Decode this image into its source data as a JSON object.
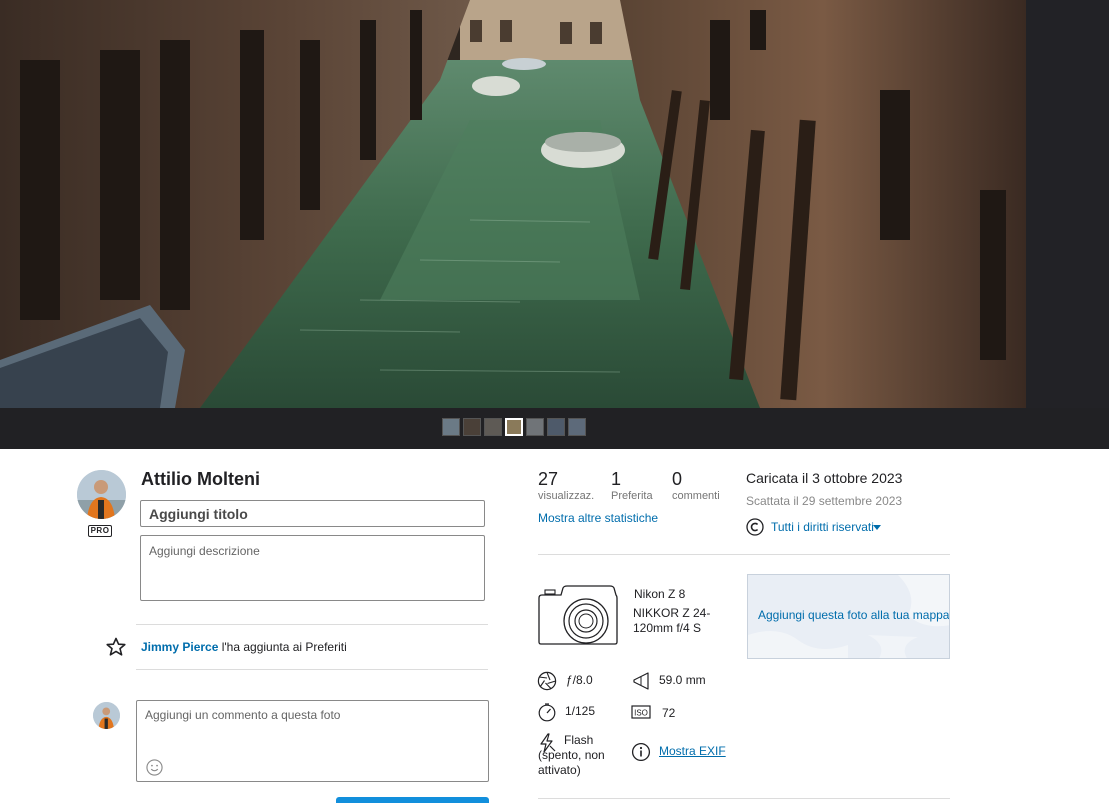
{
  "owner": {
    "name": "Attilio Molteni",
    "badge": "PRO"
  },
  "editor": {
    "title_placeholder": "Aggiungi titolo",
    "description_placeholder": "Aggiungi descrizione"
  },
  "favorite": {
    "user": "Jimmy Pierce",
    "text": " l'ha aggiunta ai Preferiti"
  },
  "comment": {
    "placeholder": "Aggiungi un commento a questa foto"
  },
  "stats": {
    "views": "27",
    "views_label": "visualizzaz.",
    "faves": "1",
    "faves_label": "Preferita",
    "comments": "0",
    "comments_label": "commenti",
    "more_link": "Mostra altre statistiche"
  },
  "dates": {
    "uploaded": "Caricata il 3 ottobre 2023",
    "taken": "Scattata il 29 settembre 2023"
  },
  "license": {
    "label": "Tutti i diritti riservati"
  },
  "camera": {
    "model": "Nikon Z 8",
    "lens": "NIKKOR Z 24-120mm f/4 S"
  },
  "map": {
    "link": "Aggiungi questa foto alla tua mappa"
  },
  "exif": {
    "aperture": "ƒ/8.0",
    "focal_length": "59.0 mm",
    "shutter": "1/125",
    "iso": "72",
    "flash": "Flash (spento, non attivato)",
    "show_exif": "Mostra EXIF"
  },
  "filmstrip": {
    "count": 7,
    "active_index": 3,
    "colors": [
      "#6b7a86",
      "#4a4038",
      "#5e5a55",
      "#8a7a5a",
      "#707478",
      "#4e5a6a",
      "#5d6a7a"
    ]
  }
}
